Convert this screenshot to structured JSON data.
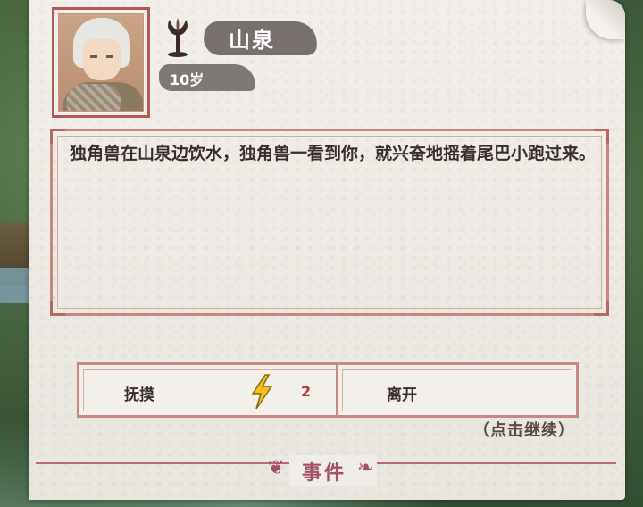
{
  "character": {
    "name": "山泉",
    "age_label": "10岁"
  },
  "event": {
    "description": "独角兽在山泉边饮水，独角兽一看到你，就兴奋地摇着尾巴小跑过来。",
    "footer_title": "事件",
    "continue_hint": "（点击继续）"
  },
  "choices": [
    {
      "label": "抚摸",
      "icon": "lightning-icon",
      "cost": "2"
    },
    {
      "label": "离开"
    }
  ],
  "colors": {
    "frame": "#c8867f",
    "footer_accent": "#a4506a",
    "cost": "#b43a2c",
    "bolt": "#f2c21a"
  }
}
